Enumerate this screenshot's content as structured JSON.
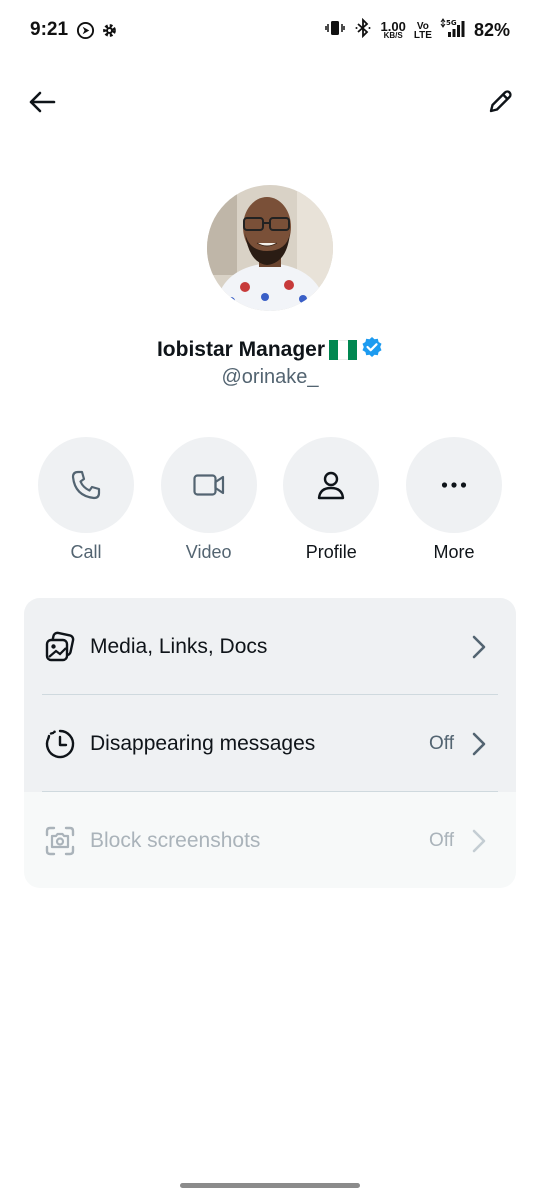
{
  "status_bar": {
    "time": "9:21",
    "speed_value": "1.00",
    "speed_unit": "KB/S",
    "volte_top": "Vo",
    "volte_bottom": "LTE",
    "network": "5G",
    "battery": "82%"
  },
  "profile": {
    "display_name": "Iobistar Manager",
    "handle": "@orinake_",
    "verified_color": "#1d9bf0",
    "flag_colors": [
      "#008751",
      "#ffffff",
      "#008751"
    ]
  },
  "actions": [
    {
      "label": "Call",
      "icon": "phone-icon",
      "enabled": false
    },
    {
      "label": "Video",
      "icon": "video-icon",
      "enabled": false
    },
    {
      "label": "Profile",
      "icon": "person-icon",
      "enabled": true
    },
    {
      "label": "More",
      "icon": "more-icon",
      "enabled": true
    }
  ],
  "settings": {
    "media": {
      "label": "Media, Links, Docs",
      "icon": "media-icon"
    },
    "disappearing": {
      "label": "Disappearing messages",
      "value": "Off",
      "icon": "timer-icon"
    },
    "block_screenshots": {
      "label": "Block screenshots",
      "value": "Off",
      "icon": "screenshot-icon",
      "enabled": false
    }
  }
}
